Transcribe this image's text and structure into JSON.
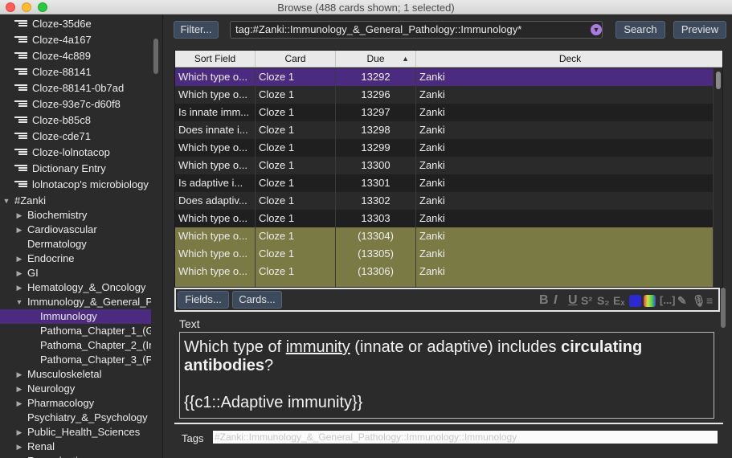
{
  "window": {
    "title": "Browse (488 cards shown; 1 selected)"
  },
  "sidebar": {
    "items": [
      {
        "label": "Cloze-35d6e",
        "type": "notetype",
        "depth": 0
      },
      {
        "label": "Cloze-4a167",
        "type": "notetype",
        "depth": 0
      },
      {
        "label": "Cloze-4c889",
        "type": "notetype",
        "depth": 0
      },
      {
        "label": "Cloze-88141",
        "type": "notetype",
        "depth": 0
      },
      {
        "label": "Cloze-88141-0b7ad",
        "type": "notetype",
        "depth": 0
      },
      {
        "label": "Cloze-93e7c-d60f8",
        "type": "notetype",
        "depth": 0
      },
      {
        "label": "Cloze-b85c8",
        "type": "notetype",
        "depth": 0
      },
      {
        "label": "Cloze-cde71",
        "type": "notetype",
        "depth": 0
      },
      {
        "label": "Cloze-lolnotacop",
        "type": "notetype",
        "depth": 0
      },
      {
        "label": "Dictionary Entry",
        "type": "notetype",
        "depth": 0
      },
      {
        "label": "lolnotacop's microbiology",
        "type": "notetype",
        "depth": 0
      },
      {
        "label": "#Zanki",
        "type": "tag",
        "depth": 0,
        "arrow": "down"
      },
      {
        "label": "Biochemistry",
        "type": "tag",
        "depth": 1,
        "arrow": "right"
      },
      {
        "label": "Cardiovascular",
        "type": "tag",
        "depth": 1,
        "arrow": "right"
      },
      {
        "label": "Dermatology",
        "type": "tag",
        "depth": 1,
        "arrow": ""
      },
      {
        "label": "Endocrine",
        "type": "tag",
        "depth": 1,
        "arrow": "right"
      },
      {
        "label": "GI",
        "type": "tag",
        "depth": 1,
        "arrow": "right"
      },
      {
        "label": "Hematology_&_Oncology",
        "type": "tag",
        "depth": 1,
        "arrow": "right"
      },
      {
        "label": "Immunology_&_General_P...",
        "type": "tag",
        "depth": 1,
        "arrow": "down"
      },
      {
        "label": "Immunology",
        "type": "tag",
        "depth": 2,
        "arrow": "",
        "selected": true
      },
      {
        "label": "Pathoma_Chapter_1_(Gr...",
        "type": "tag",
        "depth": 2,
        "arrow": ""
      },
      {
        "label": "Pathoma_Chapter_2_(In...",
        "type": "tag",
        "depth": 2,
        "arrow": ""
      },
      {
        "label": "Pathoma_Chapter_3_(Pr...",
        "type": "tag",
        "depth": 2,
        "arrow": ""
      },
      {
        "label": "Musculoskeletal",
        "type": "tag",
        "depth": 1,
        "arrow": "right"
      },
      {
        "label": "Neurology",
        "type": "tag",
        "depth": 1,
        "arrow": "right"
      },
      {
        "label": "Pharmacology",
        "type": "tag",
        "depth": 1,
        "arrow": "right"
      },
      {
        "label": "Psychiatry_&_Psychology",
        "type": "tag",
        "depth": 1,
        "arrow": ""
      },
      {
        "label": "Public_Health_Sciences",
        "type": "tag",
        "depth": 1,
        "arrow": "right"
      },
      {
        "label": "Renal",
        "type": "tag",
        "depth": 1,
        "arrow": "right"
      },
      {
        "label": "Reproductive",
        "type": "tag",
        "depth": 1,
        "arrow": "right"
      }
    ]
  },
  "toolbar": {
    "filter_label": "Filter...",
    "search_value": "tag:#Zanki::Immunology_&_General_Pathology::Immunology*",
    "search_label": "Search",
    "preview_label": "Preview"
  },
  "table": {
    "columns": [
      "Sort Field",
      "Card",
      "Due",
      "Deck"
    ],
    "rows": [
      {
        "sort_field": "Which type o...",
        "card": "Cloze 1",
        "due": "13292",
        "deck": "Zanki",
        "state": "selected"
      },
      {
        "sort_field": "Which type o...",
        "card": "Cloze 1",
        "due": "13296",
        "deck": "Zanki",
        "state": "even"
      },
      {
        "sort_field": "Is innate imm...",
        "card": "Cloze 1",
        "due": "13297",
        "deck": "Zanki",
        "state": "odd"
      },
      {
        "sort_field": "Does innate i...",
        "card": "Cloze 1",
        "due": "13298",
        "deck": "Zanki",
        "state": "even"
      },
      {
        "sort_field": "Which type o...",
        "card": "Cloze 1",
        "due": "13299",
        "deck": "Zanki",
        "state": "odd"
      },
      {
        "sort_field": "Which type o...",
        "card": "Cloze 1",
        "due": "13300",
        "deck": "Zanki",
        "state": "even"
      },
      {
        "sort_field": "Is adaptive i...",
        "card": "Cloze 1",
        "due": "13301",
        "deck": "Zanki",
        "state": "odd"
      },
      {
        "sort_field": "Does adaptiv...",
        "card": "Cloze 1",
        "due": "13302",
        "deck": "Zanki",
        "state": "even"
      },
      {
        "sort_field": "Which type o...",
        "card": "Cloze 1",
        "due": "13303",
        "deck": "Zanki",
        "state": "odd"
      },
      {
        "sort_field": "Which type o...",
        "card": "Cloze 1",
        "due": "(13304)",
        "deck": "Zanki",
        "state": "suspended"
      },
      {
        "sort_field": "Which type o...",
        "card": "Cloze 1",
        "due": "(13305)",
        "deck": "Zanki",
        "state": "suspended"
      },
      {
        "sort_field": "Which type o...",
        "card": "Cloze 1",
        "due": "(13306)",
        "deck": "Zanki",
        "state": "suspended"
      },
      {
        "sort_field": "",
        "card": "",
        "due": "",
        "deck": "",
        "state": "suspended"
      }
    ]
  },
  "editor": {
    "fields_label": "Fields...",
    "cards_label": "Cards...",
    "field_name": "Text",
    "text": {
      "part1": "Which type of ",
      "underlined": "immunity",
      "part2": " (innate or adaptive) includes ",
      "bold": "circulating antibodies",
      "part3": "?",
      "cloze": "{{c1::Adaptive immunity}}"
    },
    "tags_label": "Tags",
    "tags_value": "#Zanki::Immunology_&_General_Pathology::Immunology::Immunology"
  },
  "colors": {
    "accent": "#4b2b80",
    "suspended": "#7a7a45",
    "button": "#3c4a5c"
  }
}
